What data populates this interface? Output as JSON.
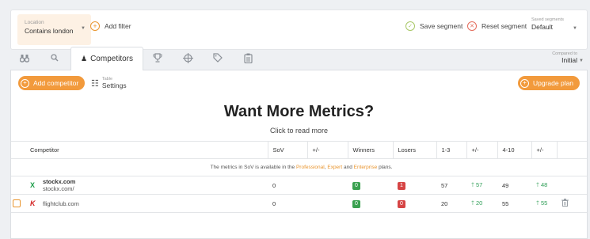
{
  "filters": {
    "location_label": "Location",
    "location_value": "Contains london",
    "add_filter": "Add filter",
    "save_segment": "Save segment",
    "reset_segment": "Reset segment",
    "saved_segments_label": "Saved segments",
    "saved_segments_value": "Default"
  },
  "tabs": {
    "active_label": "Competitors",
    "icons": [
      "binoculars-icon",
      "search-icon",
      "trophy-icon",
      "crosshair-icon",
      "tag-icon",
      "clipboard-icon"
    ],
    "compared_label": "Compared to",
    "compared_value": "Initial"
  },
  "toolbar": {
    "add_competitor": "Add competitor",
    "table_label": "Table",
    "settings_label": "Settings",
    "upgrade_plan": "Upgrade plan"
  },
  "hero": {
    "title": "Want More Metrics?",
    "subtitle": "Click to read more"
  },
  "table": {
    "columns": [
      "Competitor",
      "SoV",
      "+/-",
      "Winners",
      "Losers",
      "1-3",
      "+/-",
      "4-10",
      "+/-"
    ],
    "note_prefix": "The metrics in SoV is available in the",
    "note_professional": "Professional",
    "note_expert": "Expert",
    "note_and": "and",
    "note_enterprise": "Enterprise",
    "note_suffix": "plans.",
    "rows": [
      {
        "logo": "X",
        "name": "stockx.com",
        "url": "stockx.com/",
        "sov": "0",
        "sov_change": "",
        "winners": "0",
        "losers": "1",
        "r1_3": "57",
        "r1_3_change": "57",
        "r4_10": "49",
        "r4_10_change": "48"
      },
      {
        "logo": "K",
        "name": "flightclub.com",
        "url": "",
        "sov": "0",
        "sov_change": "",
        "winners": "0",
        "losers": "0",
        "r1_3": "20",
        "r1_3_change": "20",
        "r4_10": "55",
        "r4_10_change": "55"
      }
    ]
  },
  "colors": {
    "accent": "#f29a3c",
    "positive": "#2f9e57",
    "winner_badge": "#3aa150",
    "loser_badge": "#d64545"
  }
}
